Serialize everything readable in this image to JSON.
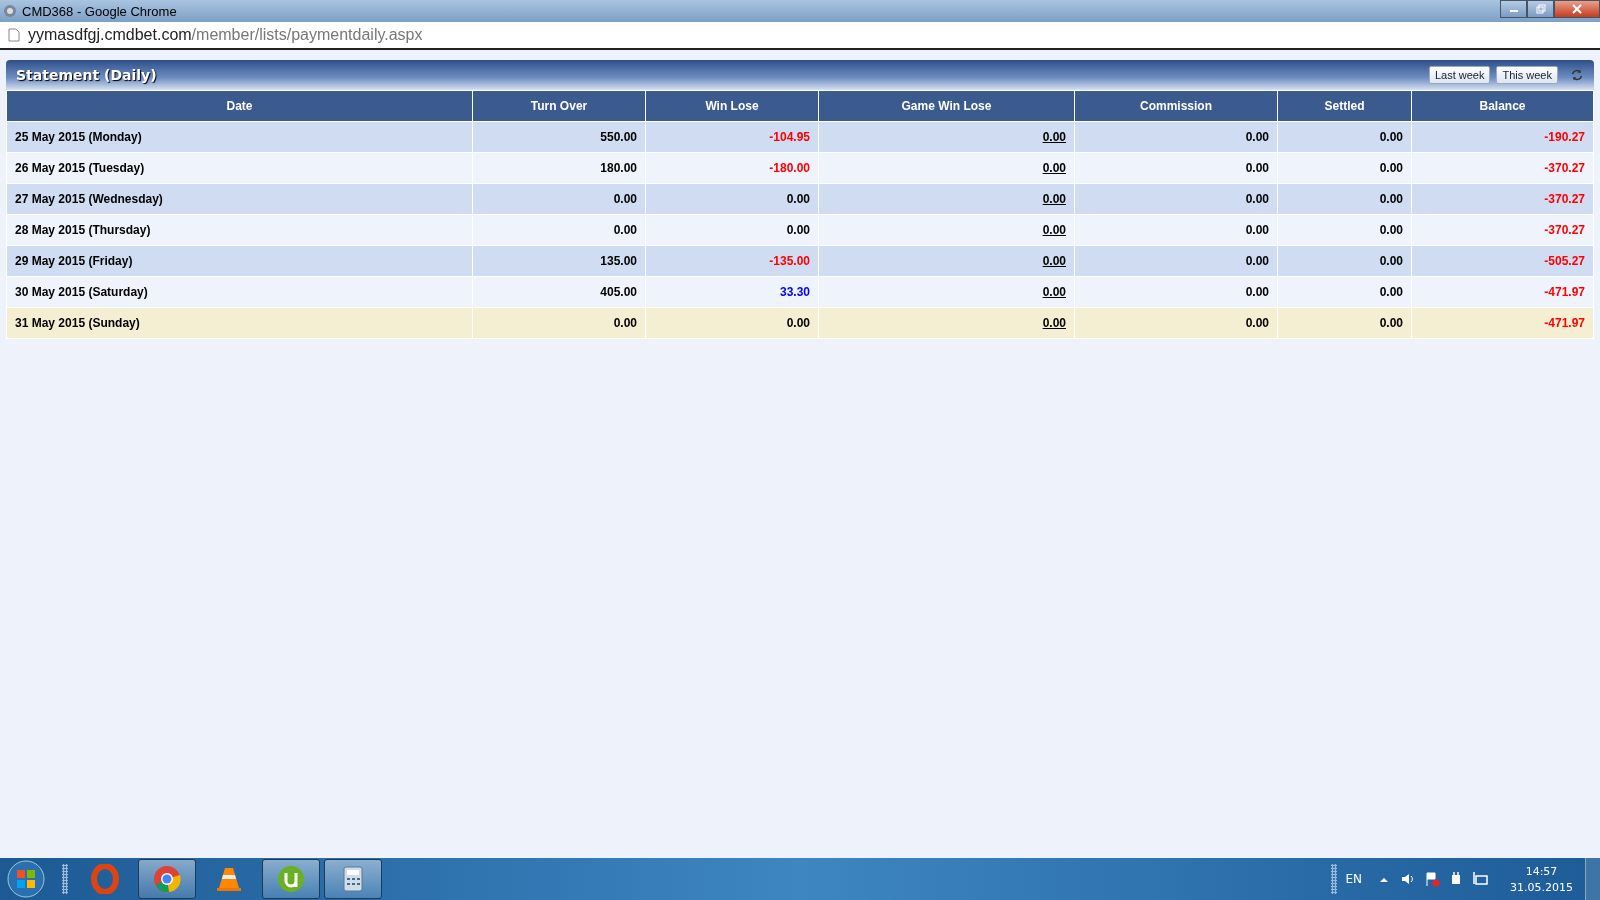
{
  "window": {
    "title": "CMD368 - Google Chrome"
  },
  "address_bar": {
    "host": "yymasdfgj.cmdbet.com",
    "path": "/member/lists/paymentdaily.aspx"
  },
  "panel": {
    "title": "Statement (Daily)",
    "buttons": [
      "Last week",
      "This week"
    ]
  },
  "table": {
    "columns": [
      "Date",
      "Turn Over",
      "Win Lose",
      "Game Win Lose",
      "Commission",
      "Settled",
      "Balance"
    ],
    "rows": [
      {
        "date": "25 May 2015 (Monday)",
        "turn_over": "550.00",
        "win_lose": {
          "text": "-104.95",
          "color": "#ff0000"
        },
        "game_win_lose": "0.00",
        "commission": "0.00",
        "settled": "0.00",
        "balance": {
          "text": "-190.27",
          "color": "#ff0000"
        },
        "current": false
      },
      {
        "date": "26 May 2015 (Tuesday)",
        "turn_over": "180.00",
        "win_lose": {
          "text": "-180.00",
          "color": "#ff0000"
        },
        "game_win_lose": "0.00",
        "commission": "0.00",
        "settled": "0.00",
        "balance": {
          "text": "-370.27",
          "color": "#ff0000"
        },
        "current": false
      },
      {
        "date": "27 May 2015 (Wednesday)",
        "turn_over": "0.00",
        "win_lose": {
          "text": "0.00",
          "color": "#000000"
        },
        "game_win_lose": "0.00",
        "commission": "0.00",
        "settled": "0.00",
        "balance": {
          "text": "-370.27",
          "color": "#ff0000"
        },
        "current": false
      },
      {
        "date": "28 May 2015 (Thursday)",
        "turn_over": "0.00",
        "win_lose": {
          "text": "0.00",
          "color": "#000000"
        },
        "game_win_lose": "0.00",
        "commission": "0.00",
        "settled": "0.00",
        "balance": {
          "text": "-370.27",
          "color": "#ff0000"
        },
        "current": false
      },
      {
        "date": "29 May 2015 (Friday)",
        "turn_over": "135.00",
        "win_lose": {
          "text": "-135.00",
          "color": "#ff0000"
        },
        "game_win_lose": "0.00",
        "commission": "0.00",
        "settled": "0.00",
        "balance": {
          "text": "-505.27",
          "color": "#ff0000"
        },
        "current": false
      },
      {
        "date": "30 May 2015 (Saturday)",
        "turn_over": "405.00",
        "win_lose": {
          "text": "33.30",
          "color": "#0000ff"
        },
        "game_win_lose": "0.00",
        "commission": "0.00",
        "settled": "0.00",
        "balance": {
          "text": "-471.97",
          "color": "#ff0000"
        },
        "current": false
      },
      {
        "date": "31 May 2015 (Sunday)",
        "turn_over": "0.00",
        "win_lose": {
          "text": "0.00",
          "color": "#000000"
        },
        "game_win_lose": "0.00",
        "commission": "0.00",
        "settled": "0.00",
        "balance": {
          "text": "-471.97",
          "color": "#ff0000"
        },
        "current": true
      }
    ]
  },
  "taskbar": {
    "apps": [
      {
        "kind": "opera",
        "open": false
      },
      {
        "kind": "chrome",
        "open": true
      },
      {
        "kind": "vlc",
        "open": false
      },
      {
        "kind": "utorrent",
        "open": true
      },
      {
        "kind": "calculator",
        "open": true
      }
    ],
    "language": "EN",
    "time": "14:57",
    "date": "31.05.2015"
  }
}
